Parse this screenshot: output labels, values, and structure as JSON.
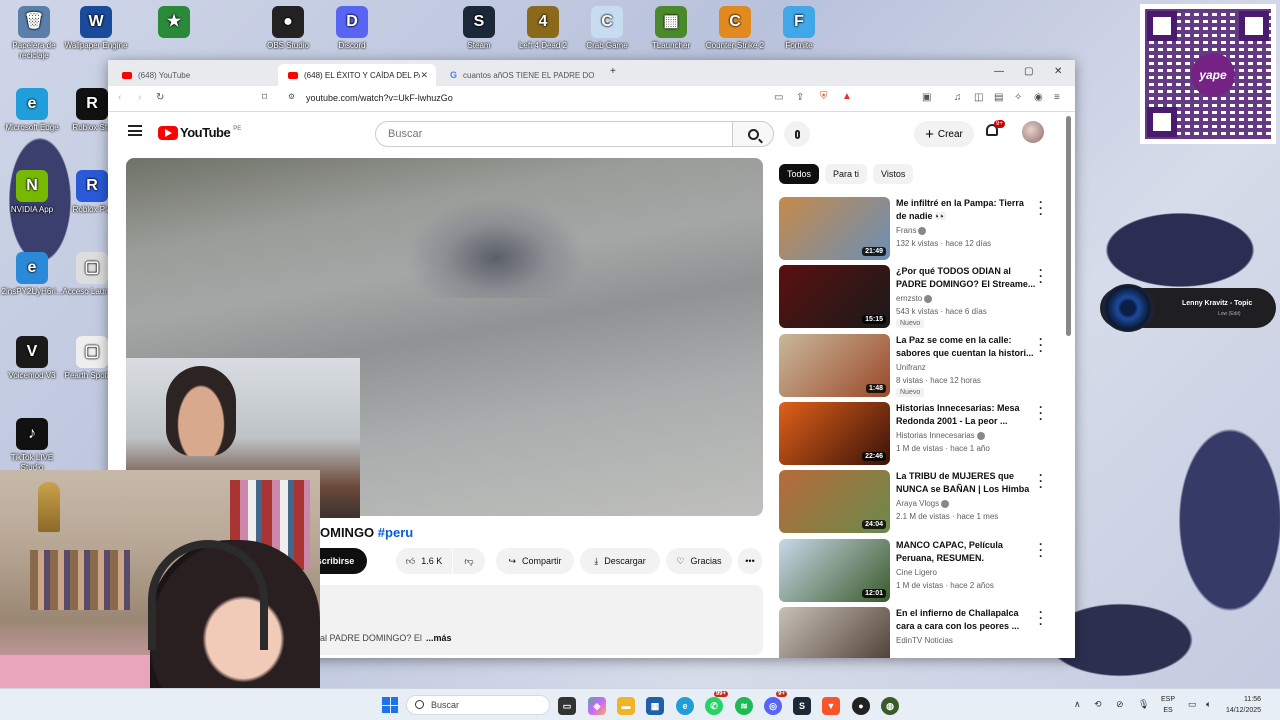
{
  "desktop": {
    "icons": [
      {
        "label": "Papelera de reciclaje",
        "glyph": "🗑"
      },
      {
        "label": "Wallpaper Engine",
        "glyph": "W"
      },
      {
        "label": "",
        "glyph": "★"
      },
      {
        "label": "OBS Studio",
        "glyph": "●"
      },
      {
        "label": "Discord",
        "glyph": "D"
      },
      {
        "label": "Steam",
        "glyph": "S"
      },
      {
        "label": "Left 4 Dead 2",
        "glyph": "4"
      },
      {
        "label": "Crab Game",
        "glyph": "C"
      },
      {
        "label": "TLauncher",
        "glyph": "▦"
      },
      {
        "label": "Counter-Strike 2",
        "glyph": "C"
      },
      {
        "label": "Fortnite",
        "glyph": "F"
      },
      {
        "label": "Microsoft Edge",
        "glyph": "e"
      },
      {
        "label": "Roblox Stu",
        "glyph": "R"
      },
      {
        "label": "NVIDIA App",
        "glyph": "N"
      },
      {
        "label": "Roblox Pla",
        "glyph": "R"
      },
      {
        "label": "2insPY2UyH6ri...",
        "glyph": "e"
      },
      {
        "label": "Acceso Launche",
        "glyph": "▢"
      },
      {
        "label": "Voicemod V3",
        "glyph": "V"
      },
      {
        "label": "Pearth Spotligh",
        "glyph": "▢"
      },
      {
        "label": "TikTok LIVE Studio",
        "glyph": "♪"
      }
    ],
    "yape_label": "yape",
    "music": {
      "title": "Lenny Kravitz - Topic",
      "sub": "Low (Edit)"
    }
  },
  "browser": {
    "tabs": [
      {
        "title": "(648) YouTube"
      },
      {
        "title": "(648) EL ÉXITO Y CAÍDA DEL PAD"
      },
      {
        "title": "cuantos añOS TIENE EL PADRE DOM"
      }
    ],
    "new_tab": "+",
    "url": "youtube.com/watch?v=UkF-lwhuzGo"
  },
  "youtube": {
    "logo_text": "YouTube",
    "country": "PE",
    "search_placeholder": "Buscar",
    "create_label": "Crear",
    "notif_badge": "9+",
    "video": {
      "title_visible": "OMINGO",
      "hashtag": "#peru",
      "subscribe_label": "scribirse",
      "likes": "1.6 K",
      "share_label": "Compartir",
      "download_label": "Descargar",
      "thanks_label": "Gracias",
      "desc_text": "al PADRE DOMINGO? El",
      "more_label": "...más"
    },
    "chips": [
      "Todos",
      "Para ti",
      "Vistos"
    ],
    "recommendations": [
      {
        "title": "Me infiltré en la Pampa: Tierra de nadie 👀",
        "channel": "Frans",
        "verified": true,
        "meta": "132 k vistas · hace 12 días",
        "duration": "21:49",
        "badge": "",
        "colors": [
          "#c58a4a",
          "#6a8fb8"
        ]
      },
      {
        "title": "¿Por qué TODOS ODIAN al PADRE DOMINGO? El Streame...",
        "channel": "ernzsto",
        "verified": true,
        "meta": "543 k vistas · hace 6 días",
        "duration": "15:15",
        "badge": "Nuevo",
        "colors": [
          "#5a1010",
          "#1a1a1a"
        ]
      },
      {
        "title": "La Paz se come en la calle: sabores que cuentan la histori...",
        "channel": "Unifranz",
        "verified": false,
        "meta": "8 vistas · hace 12 horas",
        "duration": "1:48",
        "badge": "Nuevo",
        "colors": [
          "#c8b89a",
          "#9b4a2a"
        ]
      },
      {
        "title": "Historias Innecesarias: Mesa Redonda 2001 - La peor ...",
        "channel": "Historias Innecesarias",
        "verified": true,
        "meta": "1 M de vistas · hace 1 año",
        "duration": "22:46",
        "badge": "",
        "colors": [
          "#e0601a",
          "#3a1208"
        ]
      },
      {
        "title": "La TRIBU de MUJERES que NUNCA se BAÑAN | Los Himba",
        "channel": "Araya Vlogs",
        "verified": true,
        "meta": "2.1 M de vistas · hace 1 mes",
        "duration": "24:04",
        "badge": "",
        "colors": [
          "#b86a3a",
          "#6a8a4a"
        ]
      },
      {
        "title": "MANCO CAPAC, Película Peruana, RESUMEN.",
        "channel": "Cine Ligero",
        "verified": false,
        "meta": "1 M de vistas · hace 2 años",
        "duration": "12:01",
        "badge": "",
        "colors": [
          "#c8d8e8",
          "#3a5a2a"
        ]
      },
      {
        "title": "En el infierno de Challapalca cara a cara con los peores ...",
        "channel": "EdinTV Noticias",
        "verified": false,
        "meta": "",
        "duration": "",
        "badge": "",
        "colors": [
          "#c8c0b8",
          "#4a3a30"
        ]
      }
    ]
  },
  "taskbar": {
    "search_label": "Buscar",
    "badge_whatsapp": "99+",
    "badge_discord": "9+",
    "lang_line1": "ESP",
    "lang_line2": "ES",
    "time": "11:56",
    "date": "14/12/2025"
  }
}
